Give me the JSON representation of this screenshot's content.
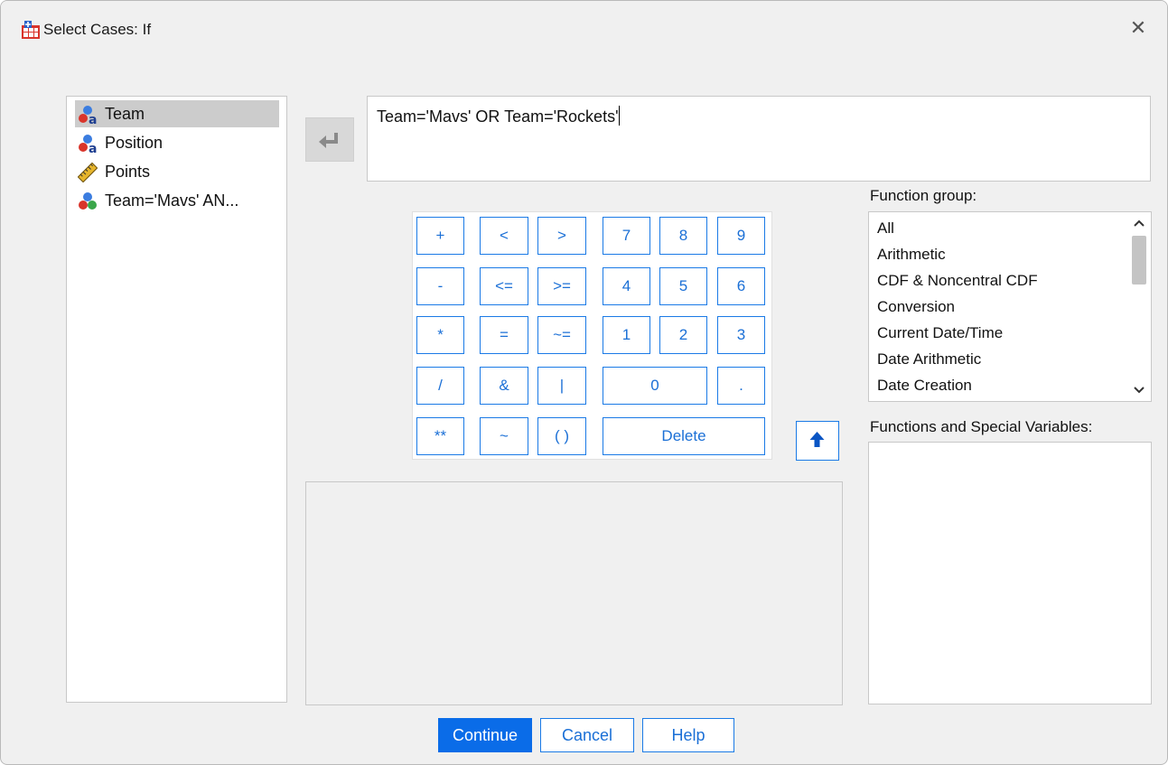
{
  "window": {
    "title": "Select Cases: If",
    "close_glyph": "✕",
    "icon": "spss-table-icon"
  },
  "variables": [
    {
      "label": "Team",
      "icon": "nominal-string-icon",
      "selected": true
    },
    {
      "label": "Position",
      "icon": "nominal-string-icon",
      "selected": false
    },
    {
      "label": "Points",
      "icon": "scale-ruler-icon",
      "selected": false
    },
    {
      "label": "Team='Mavs' AN...",
      "icon": "nominal-numeric-icon",
      "selected": false
    }
  ],
  "expression": {
    "value": "Team='Mavs' OR Team='Rockets'"
  },
  "keypad": {
    "plus": "+",
    "lt": "<",
    "gt": ">",
    "n7": "7",
    "n8": "8",
    "n9": "9",
    "minus": "-",
    "le": "<=",
    "ge": ">=",
    "n4": "4",
    "n5": "5",
    "n6": "6",
    "times": "*",
    "eq": "=",
    "ne": "~=",
    "n1": "1",
    "n2": "2",
    "n3": "3",
    "divide": "/",
    "and": "&",
    "or": "|",
    "n0": "0",
    "dot": ".",
    "power": "**",
    "not": "~",
    "parens": "( )",
    "delete": "Delete"
  },
  "function_group": {
    "label": "Function group:",
    "items": [
      "All",
      "Arithmetic",
      "CDF & Noncentral CDF",
      "Conversion",
      "Current Date/Time",
      "Date Arithmetic",
      "Date Creation"
    ]
  },
  "functions": {
    "label": "Functions and Special Variables:"
  },
  "buttons": {
    "continue": "Continue",
    "cancel": "Cancel",
    "help": "Help"
  },
  "colors": {
    "accent": "#0a6ce8",
    "button_text": "#1a6fd6",
    "dialog_bg": "#f0f0f0"
  }
}
